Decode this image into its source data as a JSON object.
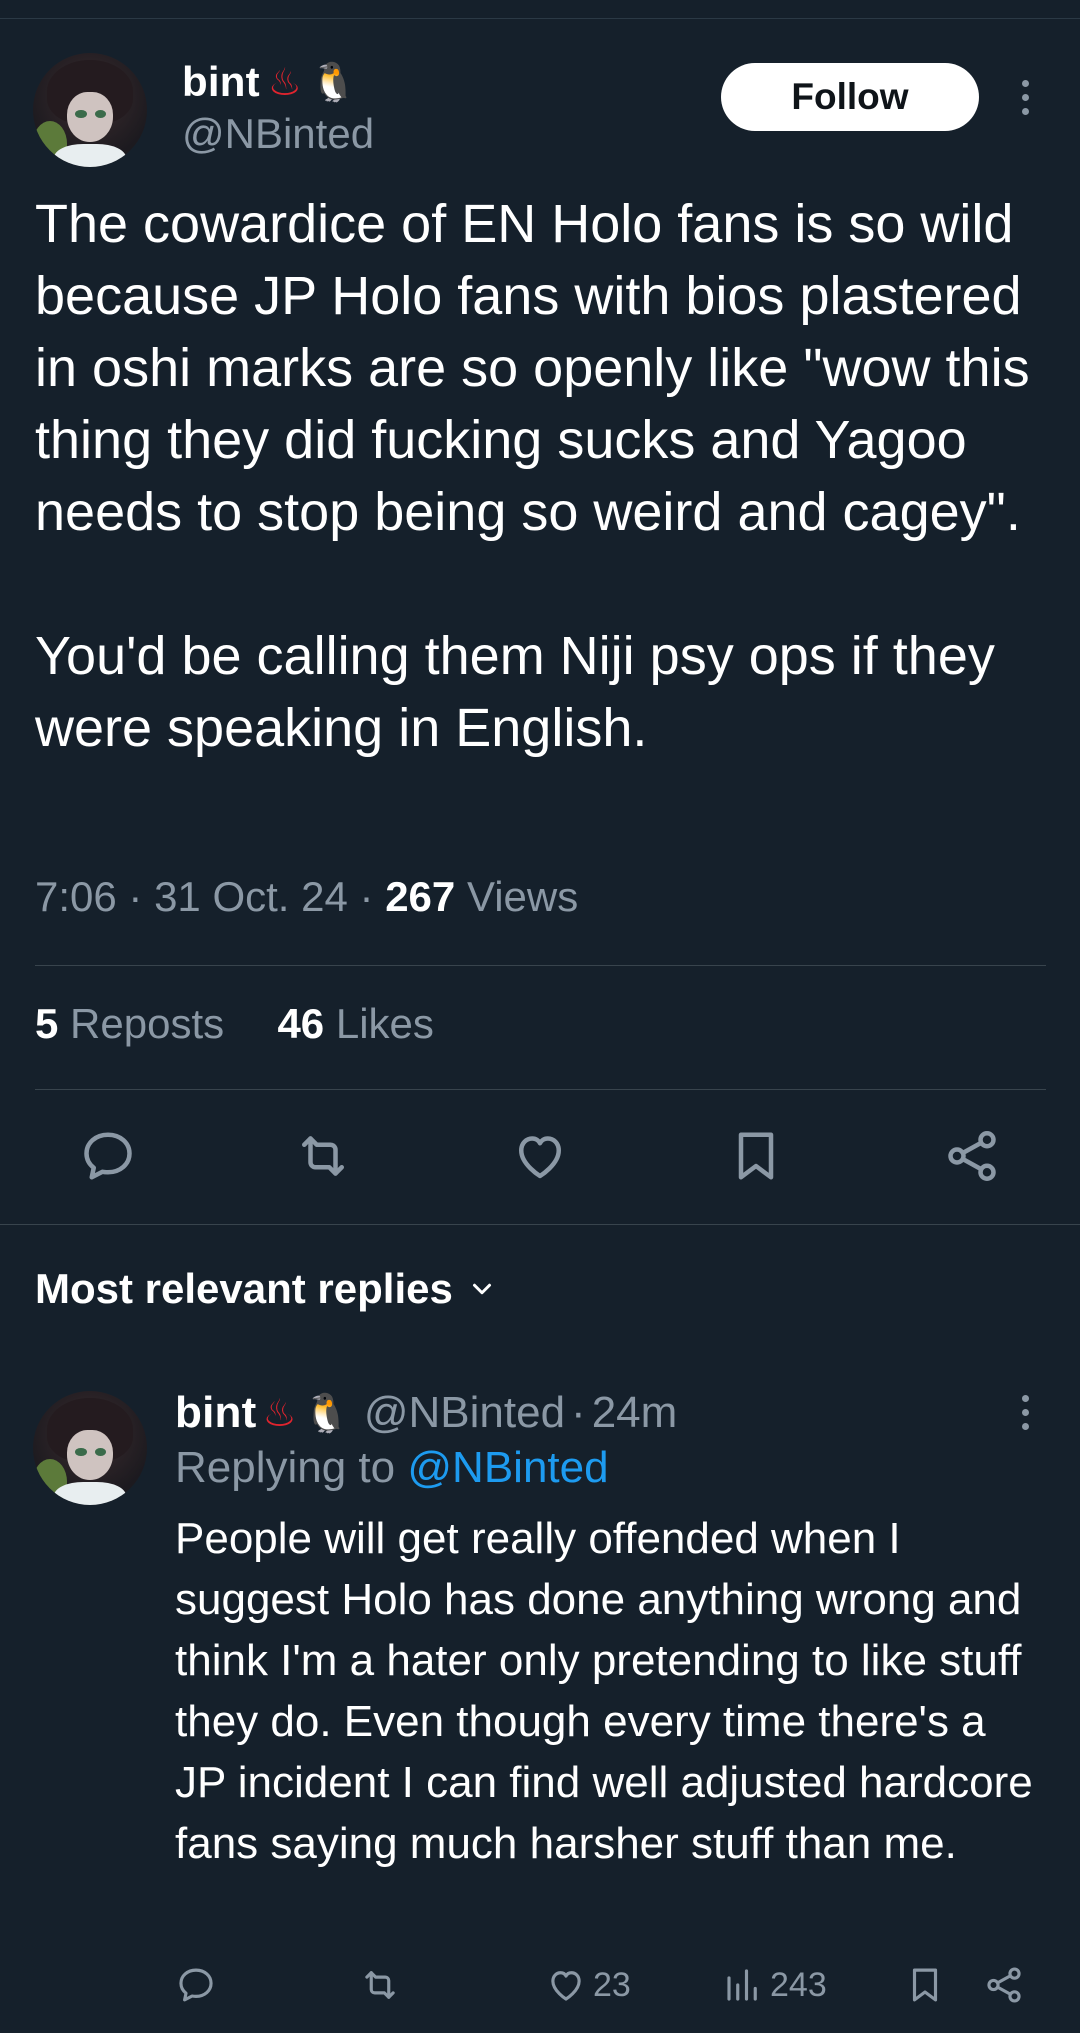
{
  "tweet": {
    "author": {
      "display_name": "bint",
      "name_emojis": [
        "♨",
        "🐧"
      ],
      "handle": "@NBinted",
      "avatar_icon": "anime-avatar"
    },
    "follow_label": "Follow",
    "text": "The cowardice of EN Holo fans is so wild because JP Holo fans with bios plastered in oshi marks are so openly like \"wow this thing they did fucking sucks and Yagoo needs to stop being so weird and cagey\".\n\nYou'd be calling them Niji psy ops if they were speaking in English.",
    "time": "7:06",
    "date": "31 Oct. 24",
    "views_count": "267",
    "views_label": "Views",
    "reposts_count": "5",
    "reposts_label": "Reposts",
    "likes_count": "46",
    "likes_label": "Likes",
    "actions": [
      "reply-icon",
      "repost-icon",
      "like-icon",
      "bookmark-icon",
      "share-icon"
    ]
  },
  "replies_section": {
    "title": "Most relevant replies"
  },
  "reply": {
    "author": {
      "display_name": "bint",
      "name_emojis": [
        "♨",
        "🐧"
      ],
      "handle": "@NBinted"
    },
    "time_ago": "24m",
    "replying_prefix": "Replying to",
    "replying_handle": "@NBinted",
    "text": "People will get really offended when I suggest Holo has done anything wrong and think I'm a hater only pretending to like stuff they do. Even though every time there's a JP incident I can find well adjusted hardcore fans saying much harsher stuff than me.",
    "likes": "23",
    "views": "243"
  },
  "colors": {
    "background": "#15202b",
    "secondary_text": "#8b98a5",
    "link": "#1d9bf0",
    "divider": "#38444d"
  }
}
